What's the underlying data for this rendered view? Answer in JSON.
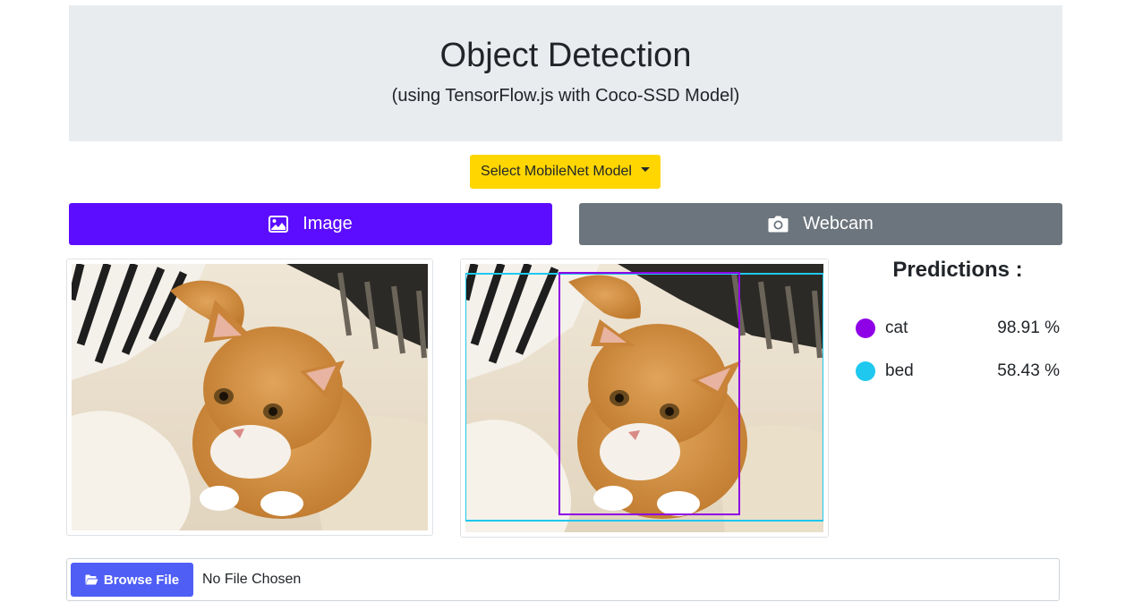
{
  "header": {
    "title": "Object Detection",
    "subtitle": "(using TensorFlow.js with Coco-SSD Model)"
  },
  "model_select": {
    "label": "Select MobileNet Model"
  },
  "tabs": [
    {
      "label": "Image",
      "icon": "image-icon",
      "active": true,
      "color": "#5c0dff"
    },
    {
      "label": "Webcam",
      "icon": "camera-icon",
      "active": false,
      "color": "#6c757d"
    }
  ],
  "predictions": {
    "title": "Predictions :",
    "items": [
      {
        "label": "cat",
        "value": "98.91 %",
        "color": "#8e00e5"
      },
      {
        "label": "bed",
        "value": "58.43 %",
        "color": "#1ec8ee"
      }
    ]
  },
  "file_input": {
    "button_label": "Browse File",
    "icon": "folder-open-icon",
    "status": "No File Chosen"
  }
}
